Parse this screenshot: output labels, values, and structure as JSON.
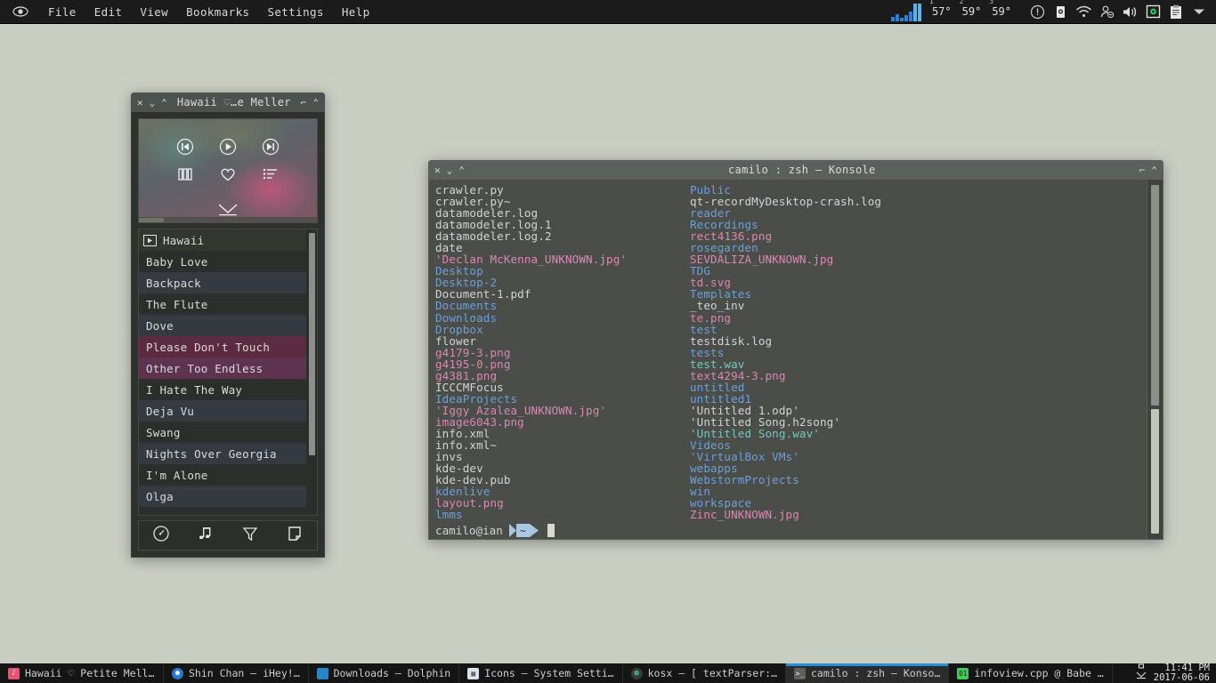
{
  "menubar": {
    "app_icon": "eye-icon",
    "items": [
      "File",
      "Edit",
      "View",
      "Bookmarks",
      "Settings",
      "Help"
    ]
  },
  "tray": {
    "monitor_icon": "system-monitor-graph",
    "temperatures": [
      {
        "index": "1",
        "value": "57°"
      },
      {
        "index": "2",
        "value": "59°"
      },
      {
        "index": "3",
        "value": "59°"
      }
    ],
    "icons": [
      "notification-circle-icon",
      "device-notifier-icon",
      "wifi-icon",
      "user-status-icon",
      "volume-icon",
      "display-settings-icon",
      "clipboard-icon",
      "chevron-down-icon"
    ]
  },
  "player": {
    "title": "Hawaii ♡…e Meller",
    "window_buttons": {
      "close": "✕",
      "minimize": "⌄",
      "maximize": "⌃",
      "shade": "⌐",
      "pin": "⌃"
    },
    "art": {
      "controls": [
        "previous-icon",
        "play-icon",
        "next-icon",
        "equalizer-icon",
        "favorite-icon",
        "playlist-icon"
      ],
      "collapse": "chevron-down-icon"
    },
    "now_playing": "Hawaii",
    "tracks": [
      {
        "label": "Baby Love",
        "style": "plain"
      },
      {
        "label": "Backpack",
        "style": "alt"
      },
      {
        "label": "The Flute",
        "style": "plain"
      },
      {
        "label": "Dove",
        "style": "alt"
      },
      {
        "label": "Please Don't Touch",
        "style": "pink"
      },
      {
        "label": "Other Too Endless",
        "style": "purple"
      },
      {
        "label": "I Hate The Way",
        "style": "plain"
      },
      {
        "label": "Deja Vu",
        "style": "alt"
      },
      {
        "label": "Swang",
        "style": "plain"
      },
      {
        "label": "Nights Over Georgia",
        "style": "alt"
      },
      {
        "label": "I'm Alone",
        "style": "plain"
      },
      {
        "label": "Olga",
        "style": "alt"
      }
    ],
    "toolbar": [
      "info-gauge-icon",
      "music-note-icon",
      "filter-funnel-icon",
      "playlist-page-icon"
    ]
  },
  "konsole": {
    "title": "camilo : zsh — Konsole",
    "window_buttons": {
      "close": "✕",
      "minimize": "⌄",
      "maximize": "⌃"
    },
    "columns": [
      [
        {
          "name": "crawler.py",
          "type": "file"
        },
        {
          "name": "crawler.py~",
          "type": "file"
        },
        {
          "name": "datamodeler.log",
          "type": "file"
        },
        {
          "name": "datamodeler.log.1",
          "type": "file"
        },
        {
          "name": "datamodeler.log.2",
          "type": "file"
        },
        {
          "name": "date",
          "type": "file"
        },
        {
          "name": "'Declan McKenna_UNKNOWN.jpg'",
          "type": "image"
        },
        {
          "name": "Desktop",
          "type": "dir"
        },
        {
          "name": "Desktop-2",
          "type": "dir"
        },
        {
          "name": "Document-1.pdf",
          "type": "file"
        },
        {
          "name": "Documents",
          "type": "dir"
        },
        {
          "name": "Downloads",
          "type": "dir"
        },
        {
          "name": "Dropbox",
          "type": "dir"
        },
        {
          "name": "flower",
          "type": "file"
        },
        {
          "name": "g4179-3.png",
          "type": "image"
        },
        {
          "name": "g4195-0.png",
          "type": "image"
        },
        {
          "name": "g4381.png",
          "type": "image"
        },
        {
          "name": "ICCCMFocus",
          "type": "file"
        },
        {
          "name": "IdeaProjects",
          "type": "dir"
        },
        {
          "name": "'Iggy Azalea_UNKNOWN.jpg'",
          "type": "image"
        },
        {
          "name": "image6043.png",
          "type": "image"
        },
        {
          "name": "info.xml",
          "type": "file"
        },
        {
          "name": "info.xml~",
          "type": "file"
        },
        {
          "name": "invs",
          "type": "file"
        },
        {
          "name": "kde-dev",
          "type": "file"
        },
        {
          "name": "kde-dev.pub",
          "type": "file"
        },
        {
          "name": "kdenlive",
          "type": "dir"
        },
        {
          "name": "layout.png",
          "type": "image"
        },
        {
          "name": "lmms",
          "type": "dir"
        }
      ],
      [
        {
          "name": "Public",
          "type": "dir"
        },
        {
          "name": "qt-recordMyDesktop-crash.log",
          "type": "file"
        },
        {
          "name": "reader",
          "type": "dir"
        },
        {
          "name": "Recordings",
          "type": "dir"
        },
        {
          "name": "rect4136.png",
          "type": "image"
        },
        {
          "name": "rosegarden",
          "type": "dir"
        },
        {
          "name": "SEVDALIZA_UNKNOWN.jpg",
          "type": "image"
        },
        {
          "name": "TDG",
          "type": "dir"
        },
        {
          "name": "td.svg",
          "type": "image"
        },
        {
          "name": "Templates",
          "type": "dir"
        },
        {
          "name": "_teo_inv",
          "type": "file"
        },
        {
          "name": "te.png",
          "type": "image"
        },
        {
          "name": "test",
          "type": "dir"
        },
        {
          "name": "testdisk.log",
          "type": "file"
        },
        {
          "name": "tests",
          "type": "dir"
        },
        {
          "name": "test.wav",
          "type": "audio"
        },
        {
          "name": "text4294-3.png",
          "type": "image"
        },
        {
          "name": "untitled",
          "type": "dir"
        },
        {
          "name": "untitled1",
          "type": "dir"
        },
        {
          "name": "'Untitled 1.odp'",
          "type": "file"
        },
        {
          "name": "'Untitled Song.h2song'",
          "type": "file"
        },
        {
          "name": "'Untitled Song.wav'",
          "type": "audio"
        },
        {
          "name": "Videos",
          "type": "dir"
        },
        {
          "name": "'VirtualBox VMs'",
          "type": "dir"
        },
        {
          "name": "webapps",
          "type": "dir"
        },
        {
          "name": "WebstormProjects",
          "type": "dir"
        },
        {
          "name": "win",
          "type": "dir"
        },
        {
          "name": "workspace",
          "type": "dir"
        },
        {
          "name": "Zinc_UNKNOWN.jpg",
          "type": "image"
        }
      ]
    ],
    "prompt": {
      "user_host": "camilo@ian",
      "path_segment": "~"
    }
  },
  "taskbar": {
    "tasks": [
      {
        "label": "Hawaii ♡ Petite Mell…",
        "icon": "music-app-icon",
        "active": false,
        "extra_icon": "speaker-icon"
      },
      {
        "label": "Shin Chan – iHey!…",
        "icon": "browser-icon",
        "active": false
      },
      {
        "label": "Downloads – Dolphin",
        "icon": "folder-icon",
        "active": false
      },
      {
        "label": "Icons – System Setti…",
        "icon": "settings-icon",
        "active": false
      },
      {
        "label": "kosx – [ textParser:…",
        "icon": "editor-icon",
        "active": false
      },
      {
        "label": "camilo : zsh – Konso…",
        "icon": "terminal-icon",
        "active": true
      },
      {
        "label": "infoview.cpp @ Babe …",
        "icon": "qt-creator-icon",
        "active": false
      }
    ],
    "clock": {
      "time": "11:41 PM",
      "date": "2017-06-06",
      "icon": "download-activity-icon"
    }
  },
  "colors": {
    "desktop": "#c9cec2",
    "accent": "#2b8fd8",
    "terminal_bg": "#4a4d48",
    "dir": "#6f9fd8",
    "image": "#d987b5",
    "audio": "#78c4bd"
  }
}
